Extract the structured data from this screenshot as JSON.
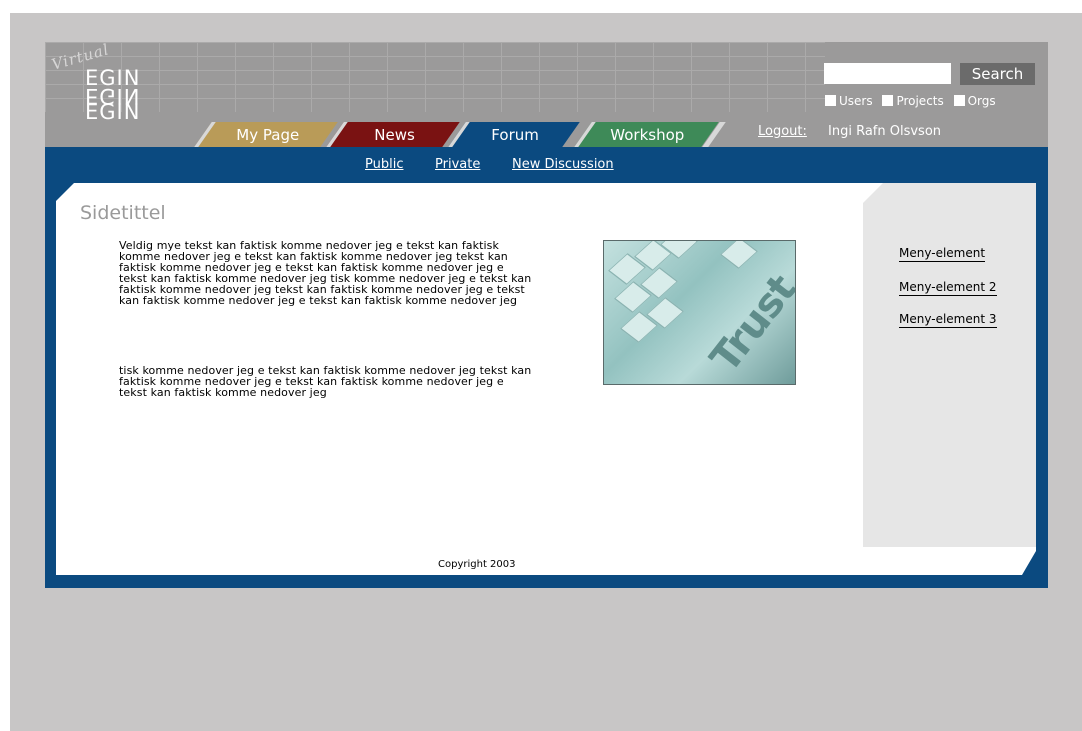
{
  "header": {
    "logo_virtual": "Virtual",
    "logo_lines": [
      "EGIN",
      "EGIN",
      "EGIN"
    ],
    "tabs": [
      {
        "label": "My Page",
        "color": "#b99b58"
      },
      {
        "label": "News",
        "color": "#7a1212"
      },
      {
        "label": "Forum",
        "color": "#0b4a80"
      },
      {
        "label": "Workshop",
        "color": "#3e8a58"
      }
    ],
    "logout_label": "Logout:",
    "user_name": "Ingi Rafn Olsvson",
    "search": {
      "value": "",
      "button_label": "Search"
    },
    "filters": [
      "Users",
      "Projects",
      "Orgs"
    ]
  },
  "subnav": {
    "public": "Public",
    "private": "Private",
    "new_discussion": "New Discussion"
  },
  "main": {
    "title": "Sidetittel",
    "paragraph1": "Veldig mye tekst kan faktisk komme nedover jeg e tekst kan faktisk komme nedover jeg e tekst kan faktisk komme nedover jeg tekst kan faktisk komme nedover jeg e tekst kan faktisk komme nedover jeg e tekst kan faktisk komme nedover jeg tisk komme nedover jeg e tekst kan faktisk komme nedover jeg tekst kan faktisk komme nedover jeg e tekst kan faktisk komme nedover jeg e tekst kan faktisk komme nedover jeg",
    "paragraph2": "tisk komme nedover jeg e tekst kan faktisk komme nedover jeg tekst kan faktisk komme nedover jeg e tekst kan faktisk komme nedover jeg e tekst kan faktisk komme nedover jeg",
    "image_text": "Trust"
  },
  "sidebar": {
    "items": [
      "Meny-element",
      "Meny-element 2",
      "Meny-element 3"
    ]
  },
  "footer": {
    "copyright": "Copyright 2003"
  },
  "colors": {
    "page_bg": "#c8c6c6",
    "header_bg": "#9b9a9a",
    "nav_blue": "#0b4a80",
    "sidebar_bg": "#e6e6e6"
  }
}
